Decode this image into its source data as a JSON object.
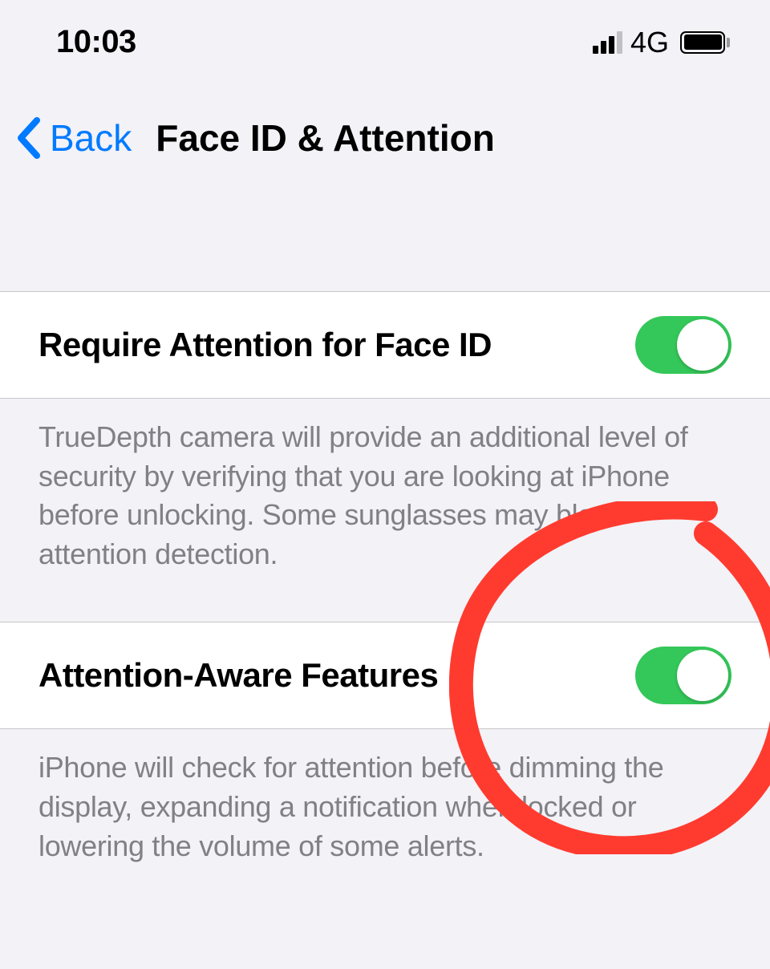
{
  "status": {
    "time": "10:03",
    "network": "4G"
  },
  "nav": {
    "back_label": "Back",
    "title": "Face ID & Attention"
  },
  "settings": [
    {
      "label": "Require Attention for Face ID",
      "enabled": true,
      "footer": "TrueDepth camera will provide an additional level of security by verifying that you are looking at iPhone before unlocking. Some sunglasses may block attention detection."
    },
    {
      "label": "Attention-Aware Features",
      "enabled": true,
      "footer": "iPhone will check for attention before dimming the display, expanding a notification when locked or lowering the volume of some alerts."
    }
  ],
  "colors": {
    "accent": "#007aff",
    "toggle_on": "#34c759",
    "annotation": "#ff3b2f"
  }
}
